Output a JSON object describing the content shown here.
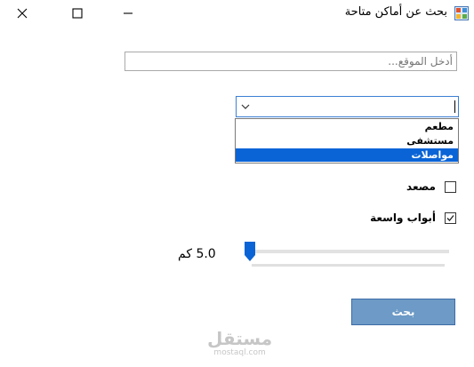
{
  "window": {
    "title": "بحث عن أماكن متاحة",
    "icon": "app-icon",
    "buttons": {
      "minimize": "minimize-icon",
      "maximize": "maximize-icon",
      "close": "close-icon"
    }
  },
  "search": {
    "value": "",
    "placeholder": "أدخل الموقع..."
  },
  "category": {
    "value": "",
    "options": [
      {
        "label": "مطعم",
        "selected": false
      },
      {
        "label": "مستشفى",
        "selected": false
      },
      {
        "label": "مواصلات",
        "selected": true
      }
    ]
  },
  "filters": {
    "elevator": {
      "label": "مصعد",
      "checked": false
    },
    "wide_doors": {
      "label": "أبواب واسعة",
      "checked": true
    }
  },
  "distance": {
    "label": "5.0 كم",
    "value_km": 5.0,
    "position_fraction": 0.0
  },
  "search_button": {
    "label": "بحث"
  },
  "watermark": {
    "main": "مستقل",
    "sub": "mostaql.com"
  },
  "colors": {
    "accent": "#0a64d6",
    "button": "#6d9ac6",
    "combo_border": "#3c7fd5"
  }
}
